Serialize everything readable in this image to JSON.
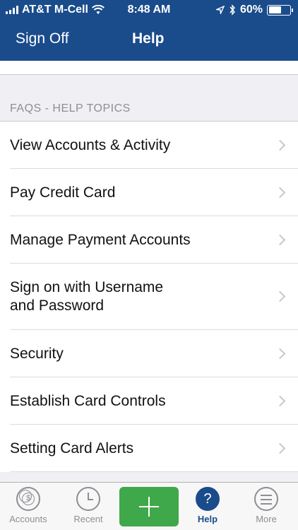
{
  "status_bar": {
    "carrier": "AT&T M-Cell",
    "time": "8:48 AM",
    "battery": "60%",
    "battery_level": 0.6,
    "icons": [
      "signal-icon",
      "wifi-icon",
      "location-icon",
      "bluetooth-icon",
      "battery-icon"
    ]
  },
  "nav": {
    "left_button": "Sign Off",
    "title": "Help"
  },
  "faq": {
    "section_title": "FAQS - HELP TOPICS",
    "items": [
      {
        "label": "View Accounts & Activity"
      },
      {
        "label": "Pay Credit Card"
      },
      {
        "label": "Manage Payment Accounts"
      },
      {
        "label": "Sign on with Username and Password"
      },
      {
        "label": "Security"
      },
      {
        "label": "Establish Card Controls"
      },
      {
        "label": "Setting Card Alerts"
      }
    ]
  },
  "tabbar": {
    "accounts": "Accounts",
    "coin_symbol": "$",
    "recent": "Recent",
    "help": "Help",
    "help_symbol": "?",
    "more": "More"
  },
  "colors": {
    "header": "#1a4c8c",
    "add_button": "#3fa84a",
    "active_tab": "#1a4c8c"
  }
}
